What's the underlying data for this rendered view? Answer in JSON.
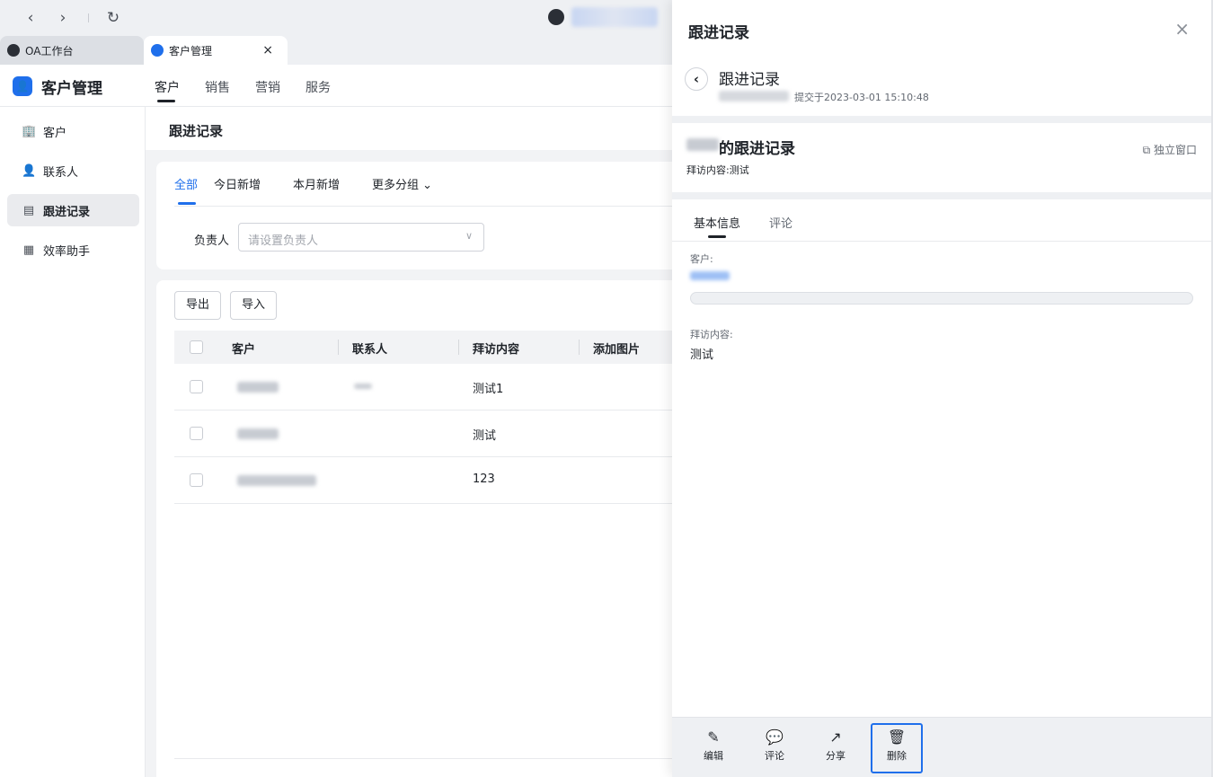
{
  "browser": {
    "back_icon": "chevron-left-icon",
    "forward_icon": "chevron-right-icon",
    "refresh_icon": "refresh-icon",
    "tabs": [
      {
        "label": "OA工作台"
      },
      {
        "label": "客户管理",
        "close": "×"
      }
    ]
  },
  "app": {
    "logo_glyph": "👤",
    "title": "客户管理",
    "top_nav": [
      "客户",
      "销售",
      "营销",
      "服务"
    ]
  },
  "sidebar": {
    "items": [
      {
        "label": "客户",
        "icon": "building-icon",
        "glyph": "🏢"
      },
      {
        "label": "联系人",
        "icon": "contact-icon",
        "glyph": "👤"
      },
      {
        "label": "跟进记录",
        "icon": "record-icon",
        "glyph": "▤"
      },
      {
        "label": "效率助手",
        "icon": "grid-icon",
        "glyph": "▦"
      }
    ]
  },
  "main": {
    "title": "跟进记录",
    "filter_tabs": [
      "全部",
      "今日新增",
      "本月新增",
      "更多分组"
    ],
    "filter_more_chevron": "⌄",
    "owner_label": "负责人",
    "owner_placeholder": "请设置负责人",
    "buttons": {
      "export": "导出",
      "import": "导入"
    },
    "columns": [
      "客户",
      "联系人",
      "拜访内容",
      "添加图片"
    ],
    "rows": [
      {
        "visit": "测试1"
      },
      {
        "visit": "测试"
      },
      {
        "visit": "123"
      }
    ]
  },
  "drawer": {
    "title": "跟进记录",
    "close": "×",
    "record_title": "跟进记录",
    "submitted_at": "提交于2023-03-01 15:10:48",
    "name_suffix_title": "的跟进记录",
    "visit_summary": "拜访内容:测试",
    "open_window": "独立窗口",
    "tabs": [
      "基本信息",
      "评论"
    ],
    "fields": {
      "customer_label": "客户:",
      "visit_label": "拜访内容:",
      "visit_value": "测试"
    },
    "footer": [
      {
        "label": "编辑",
        "glyph": "✎",
        "icon": "edit-icon"
      },
      {
        "label": "评论",
        "glyph": "💬",
        "icon": "comment-icon"
      },
      {
        "label": "分享",
        "glyph": "↗",
        "icon": "share-icon"
      },
      {
        "label": "删除",
        "glyph": "🗑",
        "icon": "trash-icon"
      }
    ]
  },
  "colors": {
    "accent": "#1f6feb",
    "text": "#1f2329",
    "muted": "#646a73",
    "bg": "#f2f3f5"
  }
}
